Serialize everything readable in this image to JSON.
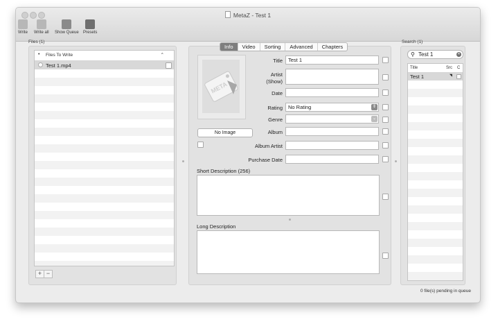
{
  "window": {
    "title": "MetaZ - Test 1"
  },
  "toolbar": {
    "items": [
      {
        "label": "Write",
        "icon": "write-icon"
      },
      {
        "label": "Write all",
        "icon": "write-all-icon"
      },
      {
        "label": "Show Queue",
        "icon": "queue-icon"
      },
      {
        "label": "Presets",
        "icon": "presets-icon"
      }
    ]
  },
  "files": {
    "label": "Files (1)",
    "header": "Files To Write",
    "rows": [
      {
        "name": "Test 1.mp4"
      }
    ],
    "add": "+",
    "remove": "−"
  },
  "tabs": [
    "Info",
    "Video",
    "Sorting",
    "Advanced",
    "Chapters"
  ],
  "info": {
    "no_image": "No Image",
    "fields": {
      "title": {
        "label": "Title",
        "value": "Test 1"
      },
      "artist": {
        "label_line1": "Artist",
        "label_line2": "(Show)",
        "value": ""
      },
      "date": {
        "label": "Date",
        "value": ""
      },
      "rating": {
        "label": "Rating",
        "value": "No Rating"
      },
      "genre": {
        "label": "Genre",
        "value": ""
      },
      "album": {
        "label": "Album",
        "value": ""
      },
      "album_artist": {
        "label": "Album Artist",
        "value": ""
      },
      "purchase_date": {
        "label": "Purchase Date",
        "value": ""
      }
    },
    "short_description": {
      "label": "Short Description (256)",
      "value": ""
    },
    "long_description": {
      "label": "Long Description",
      "value": ""
    }
  },
  "search": {
    "label": "Search (1)",
    "query": "Test 1",
    "columns": [
      "Title",
      "Src",
      "C"
    ],
    "results": [
      {
        "title": "Test 1"
      }
    ]
  },
  "status": {
    "queue": "0 file(s) pending in queue"
  }
}
